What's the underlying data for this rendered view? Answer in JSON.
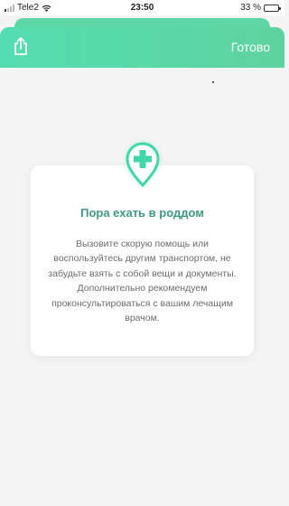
{
  "status_bar": {
    "carrier": "Tele2",
    "time": "23:50",
    "battery_percent": "33 %",
    "battery_level": 0.33
  },
  "header": {
    "done_label": "Готово",
    "share_icon": "share-icon"
  },
  "card": {
    "icon": "medical-location-pin-icon",
    "title": "Пора ехать в роддом",
    "body": "Вызовите скорую помощь или воспользуйтесь другим транспортом, не забудьте взять с собой вещи и документы. Дополнительно рекомендуем проконсультироваться с вашим лечащим врачом."
  },
  "colors": {
    "accent": "#54ddb1",
    "title": "#3e9a84",
    "background": "#f4f4f4"
  }
}
